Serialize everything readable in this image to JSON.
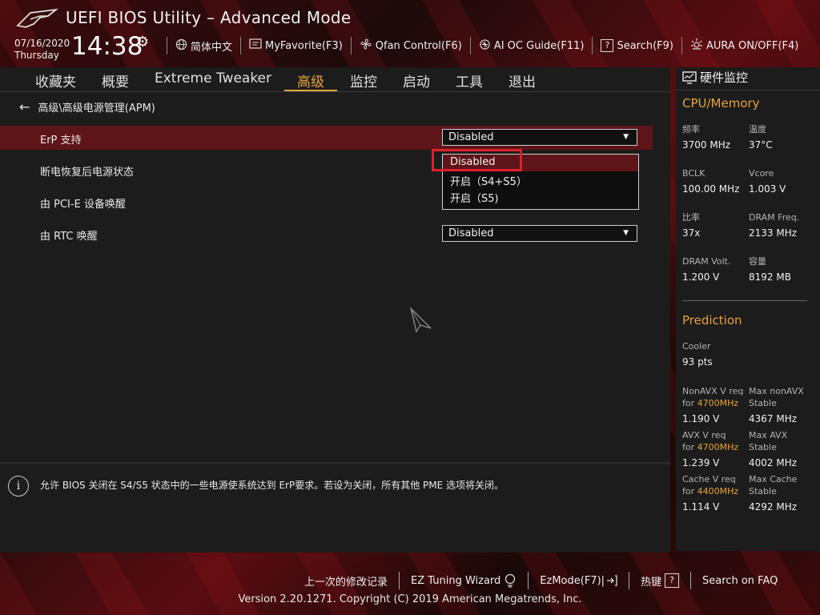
{
  "header": {
    "title": "UEFI BIOS Utility – Advanced Mode",
    "date": "07/16/2020",
    "day": "Thursday",
    "time": "14:38",
    "tools": [
      {
        "label": "简体中文",
        "icon": "globe-icon"
      },
      {
        "label": "MyFavorite(F3)",
        "icon": "favorite-icon"
      },
      {
        "label": "Qfan Control(F6)",
        "icon": "fan-icon"
      },
      {
        "label": "AI OC Guide(F11)",
        "icon": "ai-icon"
      },
      {
        "label": "Search(F9)",
        "icon": "search-icon"
      },
      {
        "label": "AURA ON/OFF(F4)",
        "icon": "aura-icon"
      }
    ]
  },
  "nav": {
    "tabs": [
      "收藏夹",
      "概要",
      "Extreme Tweaker",
      "高级",
      "监控",
      "启动",
      "工具",
      "退出"
    ],
    "active": "高级"
  },
  "breadcrumb": "高级\\高级电源管理(APM)",
  "settings": [
    {
      "label": "ErP 支持",
      "value": "Disabled"
    },
    {
      "label": "断电恢复后电源状态",
      "value": ""
    },
    {
      "label": "由 PCI-E 设备唤醒",
      "value": ""
    },
    {
      "label": "由 RTC 唤醒",
      "value": "Disabled"
    }
  ],
  "dropdown": {
    "options": [
      "Disabled",
      "开启（S4+S5）",
      "开启（S5)"
    ],
    "selected": "Disabled"
  },
  "help_text": "允许 BIOS 关闭在 S4/S5 状态中的一些电源使系统达到 ErP要求。若设为关闭，所有其他 PME 选项将关闭。",
  "monitor": {
    "title": "硬件监控",
    "cpu_memory_title": "CPU/Memory",
    "items": [
      {
        "label": "频率",
        "value": "3700 MHz"
      },
      {
        "label": "温度",
        "value": "37°C"
      },
      {
        "label": "BCLK",
        "value": "100.00 MHz"
      },
      {
        "label": "Vcore",
        "value": "1.003 V"
      },
      {
        "label": "比率",
        "value": "37x"
      },
      {
        "label": "DRAM Freq.",
        "value": "2133 MHz"
      },
      {
        "label": "DRAM Volt.",
        "value": "1.200 V"
      },
      {
        "label": "容量",
        "value": "8192 MB"
      }
    ],
    "prediction_title": "Prediction",
    "cooler_label": "Cooler",
    "cooler_value": "93 pts",
    "predictions": [
      {
        "l1": "NonAVX V req",
        "l2pre": "for ",
        "freq": "4700MHz",
        "v": "1.190 V",
        "r1": "Max nonAVX",
        "r2": "Stable",
        "rv": "4367 MHz"
      },
      {
        "l1": "AVX V req",
        "l2pre": "for ",
        "freq": "4700MHz",
        "v": "1.239 V",
        "r1": "Max AVX",
        "r2": "Stable",
        "rv": "4002 MHz"
      },
      {
        "l1": "Cache V req",
        "l2pre": "for ",
        "freq": "4400MHz",
        "v": "1.114 V",
        "r1": "Max Cache",
        "r2": "Stable",
        "rv": "4292 MHz"
      }
    ]
  },
  "footer": {
    "last_changes": "上一次的修改记录",
    "ez_tuning": "EZ Tuning Wizard",
    "ez_mode": "EzMode(F7)|",
    "hotkeys": "热键",
    "hotkeys_icon": "?",
    "faq": "Search on FAQ",
    "version": "Version 2.20.1271. Copyright (C) 2019 American Megatrends, Inc."
  },
  "colors": {
    "accent": "#e8a43a",
    "selection": "#5e1519",
    "highlight": "#e0202a"
  }
}
